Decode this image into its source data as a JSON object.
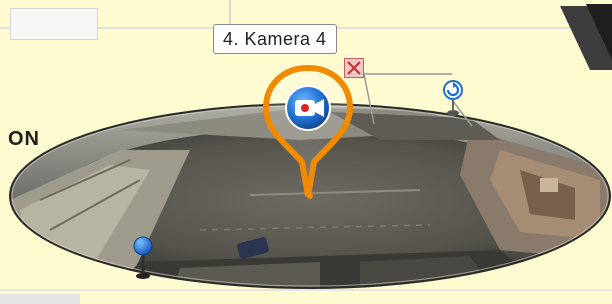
{
  "camera_label": "4. Kamera 4",
  "floor_label": "ON",
  "icons": {
    "camera": "video-camera-icon",
    "close": "close-icon",
    "rotate": "rotate-icon",
    "pin": "location-pin-icon"
  },
  "colors": {
    "background": "#fffbd0",
    "marker_orange": "#f08a00",
    "camera_blue": "#1f6fd1",
    "close_red": "#c06060"
  }
}
